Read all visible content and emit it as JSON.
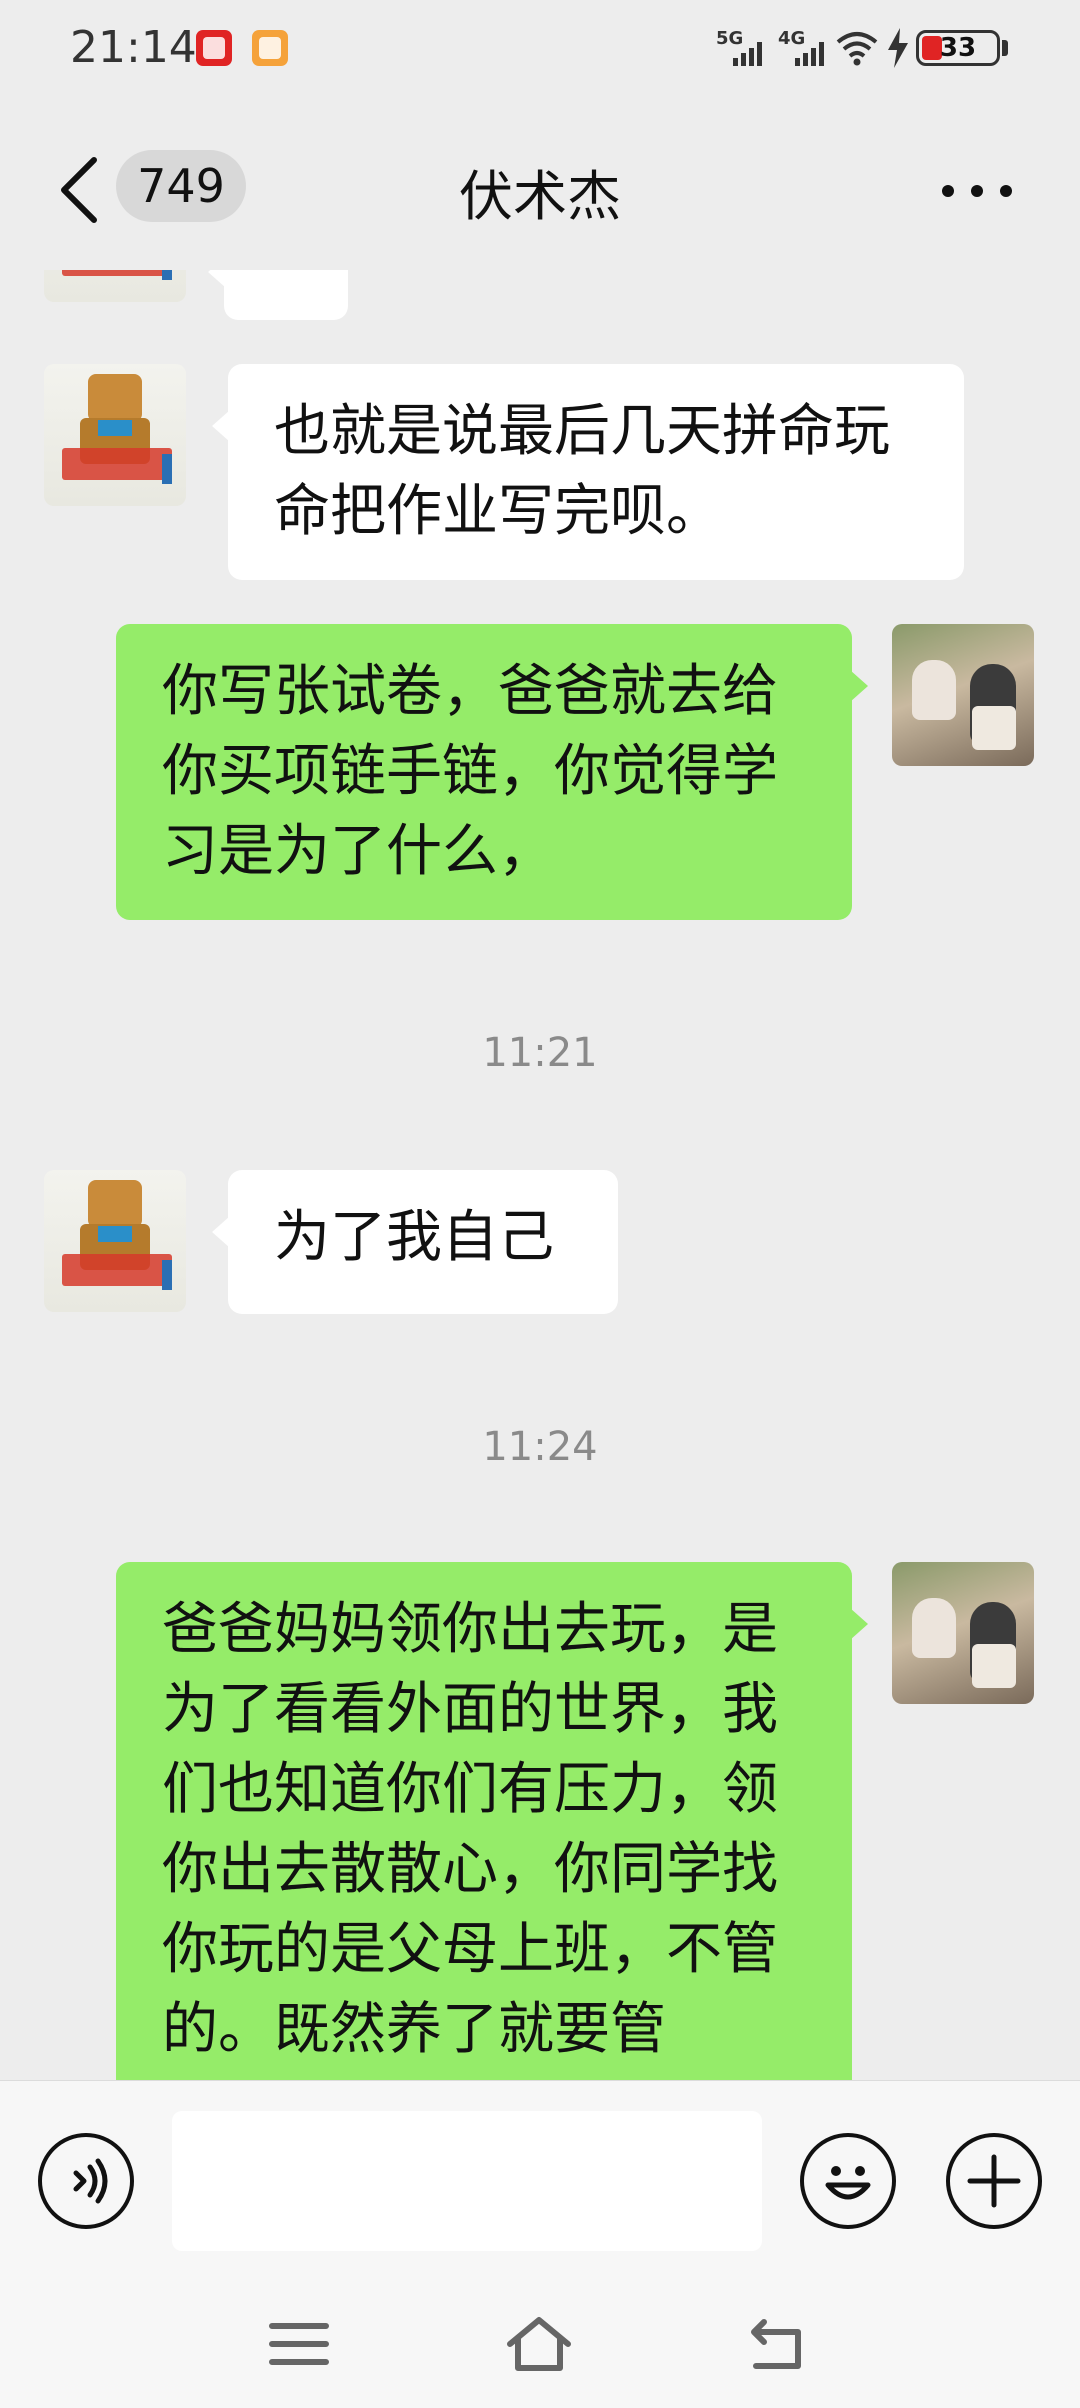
{
  "status_bar": {
    "time": "21:14",
    "network_5g": "5G",
    "network_4g": "4G",
    "battery_level": "33",
    "battery_color": "#e02424",
    "icons": [
      "app-badge-icon",
      "app-badge-icon",
      "signal-icon",
      "signal-icon",
      "wifi-icon",
      "charging-bolt-icon",
      "battery-icon"
    ]
  },
  "header": {
    "back_icon": "chevron-left-icon",
    "unread_count": "749",
    "title": "伏术杰",
    "more_icon": "more-dots-icon"
  },
  "messages": [
    {
      "sender": "contact",
      "text": "也就是说最后几天拼命玩命把作业写完呗。"
    },
    {
      "sender": "self",
      "text": "你写张试卷，爸爸就去给你买项链手链，你觉得学习是为了什么，"
    },
    {
      "sender": "system",
      "text": "11:21"
    },
    {
      "sender": "contact",
      "text": "为了我自己"
    },
    {
      "sender": "system",
      "text": "11:24"
    },
    {
      "sender": "self",
      "text": "爸爸妈妈领你出去玩，是为了看看外面的世界，我们也知道你们有压力，领你出去散散心，你同学找你玩的是父母上班，不管的。既然养了就要管"
    }
  ],
  "input_bar": {
    "voice_icon": "voice-input-icon",
    "text_value": "",
    "emoji_icon": "emoji-icon",
    "plus_icon": "plus-icon"
  },
  "nav_bar": {
    "icons": [
      "menu-icon",
      "home-icon",
      "back-icon"
    ]
  },
  "colors": {
    "background": "#ededed",
    "bubble_self": "#95ec69",
    "bubble_contact": "#ffffff",
    "timestamp": "#8a8a8a"
  }
}
